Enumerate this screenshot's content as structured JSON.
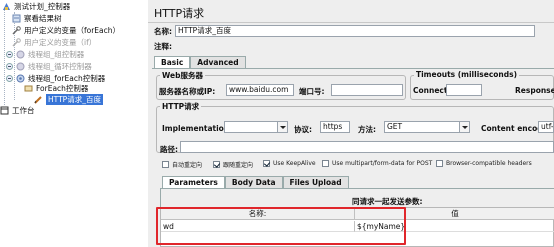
{
  "tree": {
    "items": [
      {
        "label": "测试计划_控制器",
        "state": "normal"
      },
      {
        "label": "察看结果树",
        "state": "normal"
      },
      {
        "label": "用户定义的变量（forEach）",
        "state": "normal"
      },
      {
        "label": "用户定义的变量（if）",
        "state": "disabled"
      },
      {
        "label": "线程组_组控制器",
        "state": "disabled"
      },
      {
        "label": "线程组_循环控制器",
        "state": "disabled"
      },
      {
        "label": "线程组_forEach控制器",
        "state": "normal"
      },
      {
        "label": "ForEach控制器",
        "state": "normal"
      },
      {
        "label": "HTTP请求_百度",
        "state": "selected"
      },
      {
        "label": "工作台",
        "state": "normal"
      }
    ]
  },
  "panel": {
    "title": "HTTP请求",
    "name_label": "名称:",
    "name_value": "HTTP请求_百度",
    "comment_label": "注释:",
    "tabs": [
      "Basic",
      "Advanced"
    ],
    "web_server": {
      "title": "Web服务器",
      "server_label": "服务器名称或IP:",
      "server_value": "www.baidu.com",
      "port_label": "端口号:",
      "port_value": ""
    },
    "timeouts": {
      "title": "Timeouts (milliseconds)",
      "connect_label": "Connect:",
      "response_label": "Response:"
    },
    "http_request": {
      "title": "HTTP请求",
      "implementation_label": "Implementation:",
      "implementation_value": "",
      "protocol_label": "协议:",
      "protocol_value": "https",
      "method_label": "方法:",
      "method_value": "GET",
      "encoding_label": "Content encoding:",
      "encoding_value": "utf-",
      "path_label": "路径:",
      "path_value": ""
    },
    "checkboxes": [
      {
        "label": "自动重定向",
        "checked": false
      },
      {
        "label": "跟随重定向",
        "checked": true
      },
      {
        "label": "Use KeepAlive",
        "checked": true
      },
      {
        "label": "Use multipart/form-data for POST",
        "checked": false
      },
      {
        "label": "Browser-compatible headers",
        "checked": false
      }
    ],
    "sub_tabs": [
      "Parameters",
      "Body Data",
      "Files Upload"
    ],
    "params": {
      "caption": "同请求一起发送参数:",
      "columns": [
        "名称:",
        "值"
      ],
      "rows": [
        {
          "name": "wd",
          "value": "${myName}"
        }
      ]
    }
  },
  "colors": {
    "highlight": "#e0262b",
    "selected": "#3875d7"
  }
}
